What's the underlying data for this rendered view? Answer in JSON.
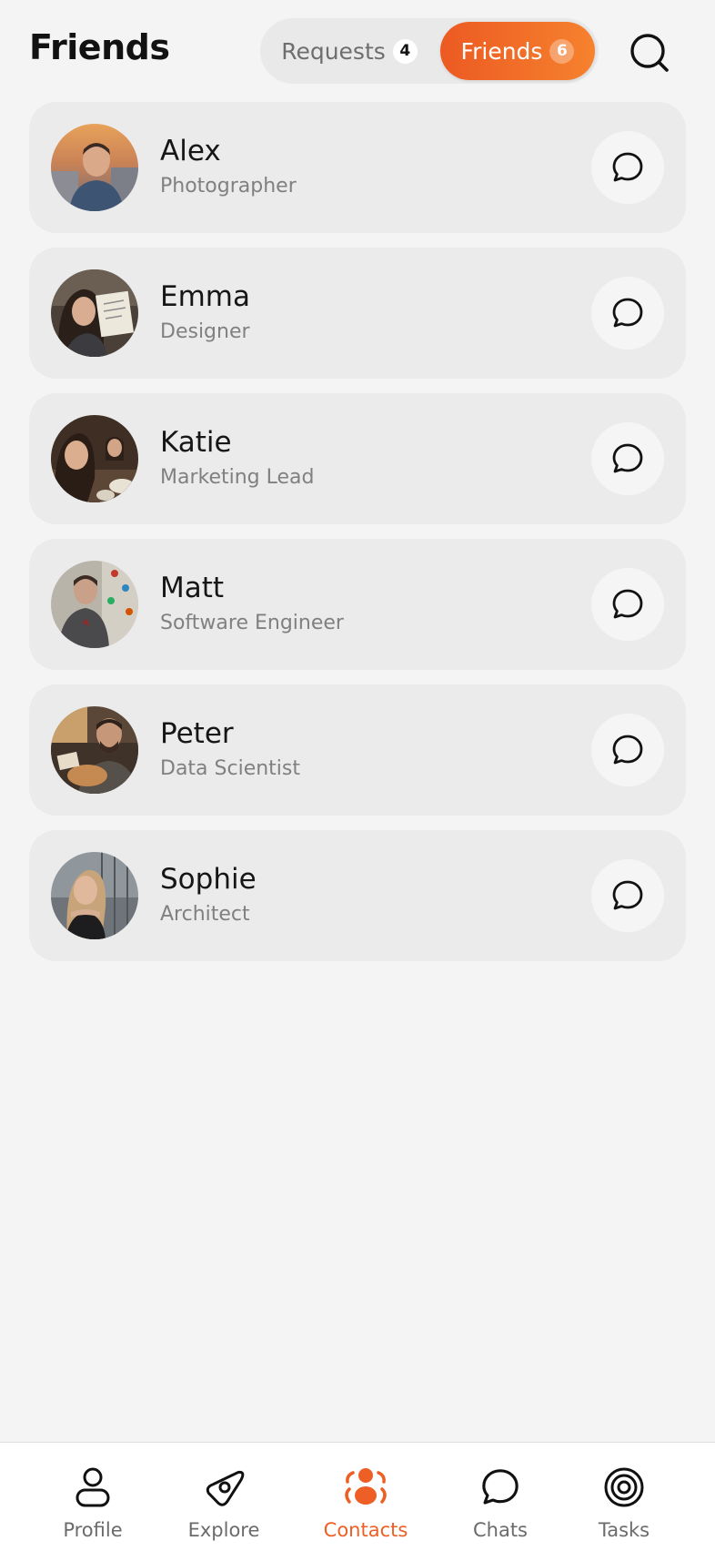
{
  "header": {
    "title": "Friends",
    "tabs": [
      {
        "label": "Requests",
        "count": "4",
        "active": false
      },
      {
        "label": "Friends",
        "count": "6",
        "active": true
      }
    ],
    "search_icon": "search-icon"
  },
  "friends": [
    {
      "name": "Alex",
      "role": "Photographer"
    },
    {
      "name": "Emma",
      "role": "Designer"
    },
    {
      "name": "Katie",
      "role": "Marketing Lead"
    },
    {
      "name": "Matt",
      "role": "Software Engineer"
    },
    {
      "name": "Peter",
      "role": "Data Scientist"
    },
    {
      "name": "Sophie",
      "role": "Architect"
    }
  ],
  "tabbar": {
    "items": [
      {
        "label": "Profile",
        "icon": "person-icon",
        "active": false
      },
      {
        "label": "Explore",
        "icon": "compass-icon",
        "active": false
      },
      {
        "label": "Contacts",
        "icon": "contacts-icon",
        "active": true
      },
      {
        "label": "Chats",
        "icon": "chat-bubble-icon",
        "active": false
      },
      {
        "label": "Tasks",
        "icon": "target-icon",
        "active": false
      }
    ]
  },
  "colors": {
    "accent_start": "#ec5a22",
    "accent_end": "#f6822e",
    "accent_text": "#ee5f25",
    "background": "#f4f4f4",
    "card": "#ebebeb"
  }
}
